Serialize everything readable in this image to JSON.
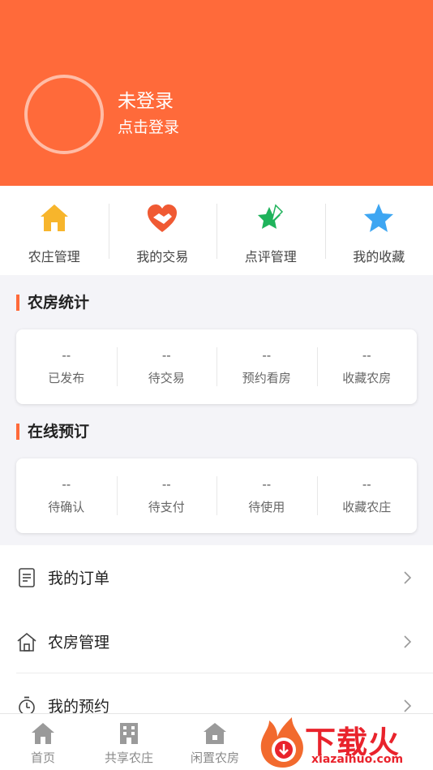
{
  "header": {
    "login_title": "未登录",
    "login_subtitle": "点击登录",
    "bg_color": "#ff6a3a"
  },
  "quick_actions": [
    {
      "label": "农庄管理",
      "icon": "house-icon"
    },
    {
      "label": "我的交易",
      "icon": "handshake-heart-icon"
    },
    {
      "label": "点评管理",
      "icon": "star-pen-icon"
    },
    {
      "label": "我的收藏",
      "icon": "star-icon"
    }
  ],
  "farmhouse_stats": {
    "title": "农房统计",
    "items": [
      {
        "value": "--",
        "label": "已发布"
      },
      {
        "value": "--",
        "label": "待交易"
      },
      {
        "value": "--",
        "label": "预约看房"
      },
      {
        "value": "--",
        "label": "收藏农房"
      }
    ]
  },
  "online_booking": {
    "title": "在线预订",
    "items": [
      {
        "value": "--",
        "label": "待确认"
      },
      {
        "value": "--",
        "label": "待支付"
      },
      {
        "value": "--",
        "label": "待使用"
      },
      {
        "value": "--",
        "label": "收藏农庄"
      }
    ]
  },
  "menu": [
    {
      "label": "我的订单",
      "icon": "document-icon"
    },
    {
      "label": "农房管理",
      "icon": "house-outline-icon"
    },
    {
      "label": "我的预约",
      "icon": "stopwatch-icon"
    }
  ],
  "tabbar": [
    {
      "label": "首页",
      "icon": "home-icon"
    },
    {
      "label": "共享农庄",
      "icon": "building-icon"
    },
    {
      "label": "闲置农房",
      "icon": "cottage-icon"
    }
  ],
  "watermark": {
    "text": "下载火",
    "url": "xiazaihuo.com"
  }
}
